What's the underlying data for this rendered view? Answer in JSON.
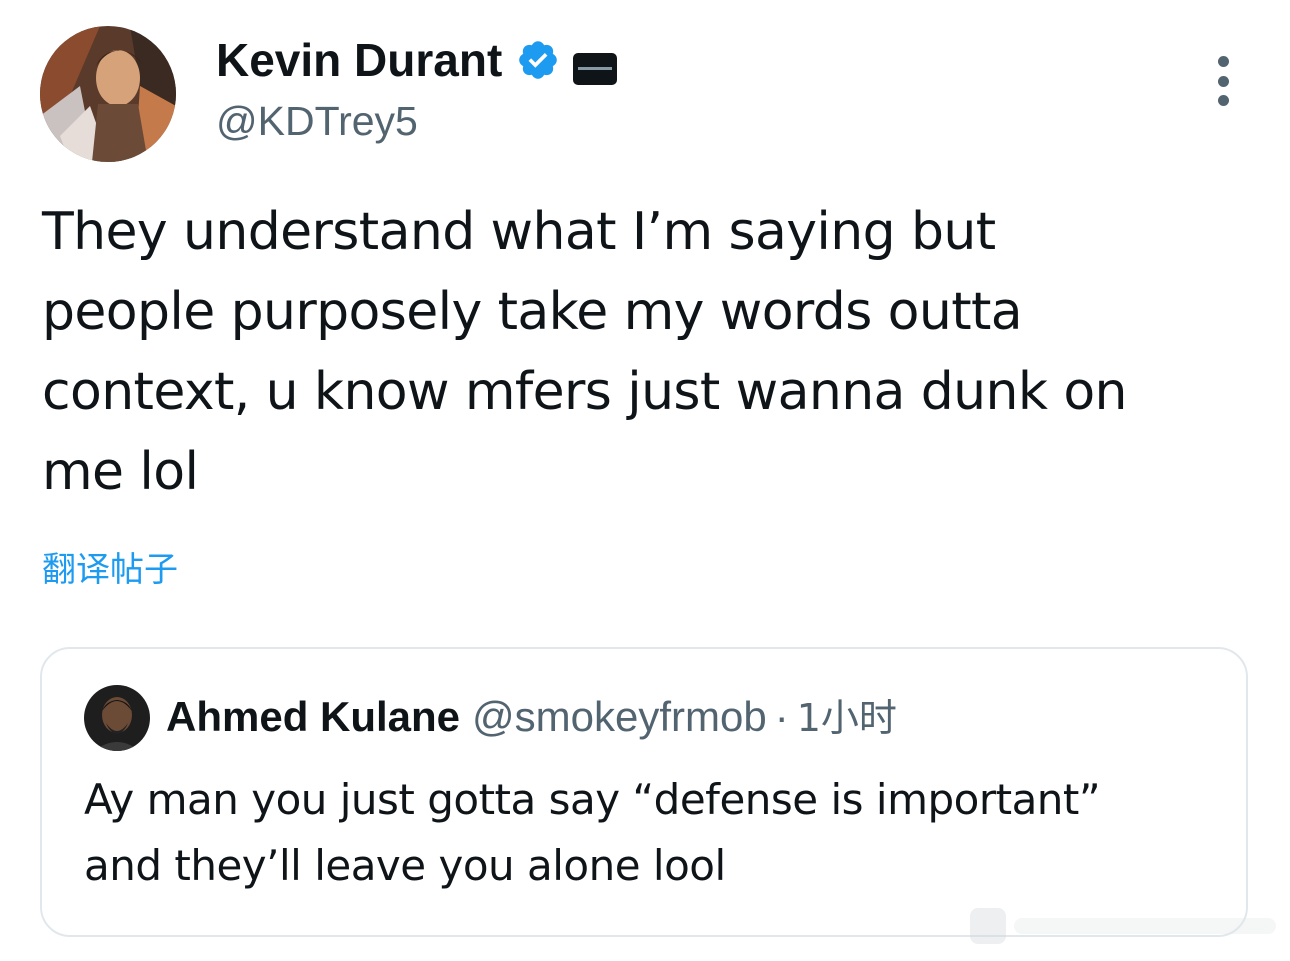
{
  "tweet": {
    "author": {
      "display_name": "Kevin Durant",
      "handle": "@KDTrey5",
      "avatar_icon": "profile-avatar",
      "verified_icon": "verified-badge-icon",
      "affiliate_icon": "affiliate-badge-icon",
      "verified_color": "#1d9bf0"
    },
    "more_icon": "more-dots-icon",
    "text": "They understand what I’m saying but\npeople purposely take my words outta\ncontext, u know mfers just wanna dunk on\nme lol",
    "translate_label": "翻译帖子",
    "link_color": "#1d9bf0"
  },
  "quoted_tweet": {
    "author": {
      "display_name": "Ahmed Kulane",
      "handle": "@smokeyfrmob",
      "avatar_icon": "profile-avatar"
    },
    "separator": "·",
    "time": "1小时",
    "text": "Ay man you just gotta say “defense is important”\nand they’ll leave you alone lool"
  },
  "colors": {
    "text": "#0f1419",
    "secondary": "#536471",
    "border": "#e1e8ed"
  }
}
